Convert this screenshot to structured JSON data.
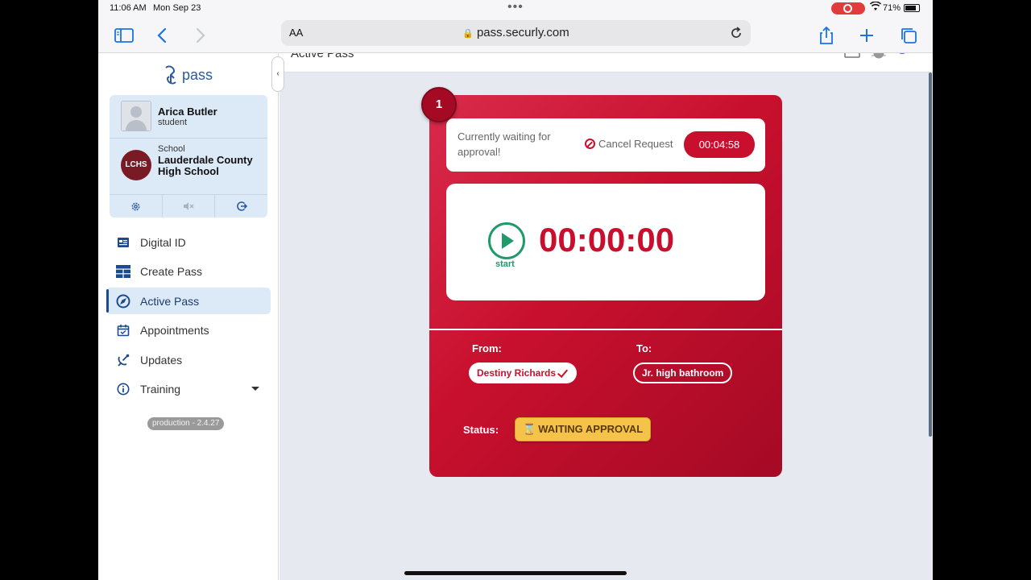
{
  "status_bar": {
    "time": "11:06 AM",
    "date": "Mon Sep 23",
    "battery": "71%"
  },
  "browser": {
    "text_size_label": "AA",
    "url": "pass.securly.com"
  },
  "sidebar": {
    "logo_text": "pass",
    "user": {
      "name": "Arica Butler",
      "role": "student"
    },
    "school": {
      "label": "School",
      "name": "Lauderdale County High School",
      "logo_text": "LCHS"
    },
    "nav": [
      {
        "label": "Digital ID",
        "icon": "id-card-icon"
      },
      {
        "label": "Create Pass",
        "icon": "grid-icon"
      },
      {
        "label": "Active Pass",
        "icon": "compass-icon",
        "active": true
      },
      {
        "label": "Appointments",
        "icon": "calendar-icon"
      },
      {
        "label": "Updates",
        "icon": "satellite-icon"
      },
      {
        "label": "Training",
        "icon": "info-icon"
      }
    ],
    "version": "production - 2.4.27"
  },
  "main": {
    "page_title": "Active Pass",
    "pass": {
      "number": "1",
      "waiting_text": "Currently waiting for approval!",
      "cancel_label": "Cancel Request",
      "countdown": "00:04:58",
      "start_label": "start",
      "elapsed": "00:00:00",
      "from_label": "From:",
      "from_value": "Destiny Richards",
      "to_label": "To:",
      "to_value": "Jr. high bathroom",
      "status_label": "Status:",
      "status_icon": "⌛",
      "status_value": "WAITING APPROVAL"
    }
  },
  "colors": {
    "brand_red": "#c8102e",
    "brand_blue": "#1c4a8c",
    "start_green": "#1f9a6b",
    "status_yellow": "#f5c34a"
  }
}
